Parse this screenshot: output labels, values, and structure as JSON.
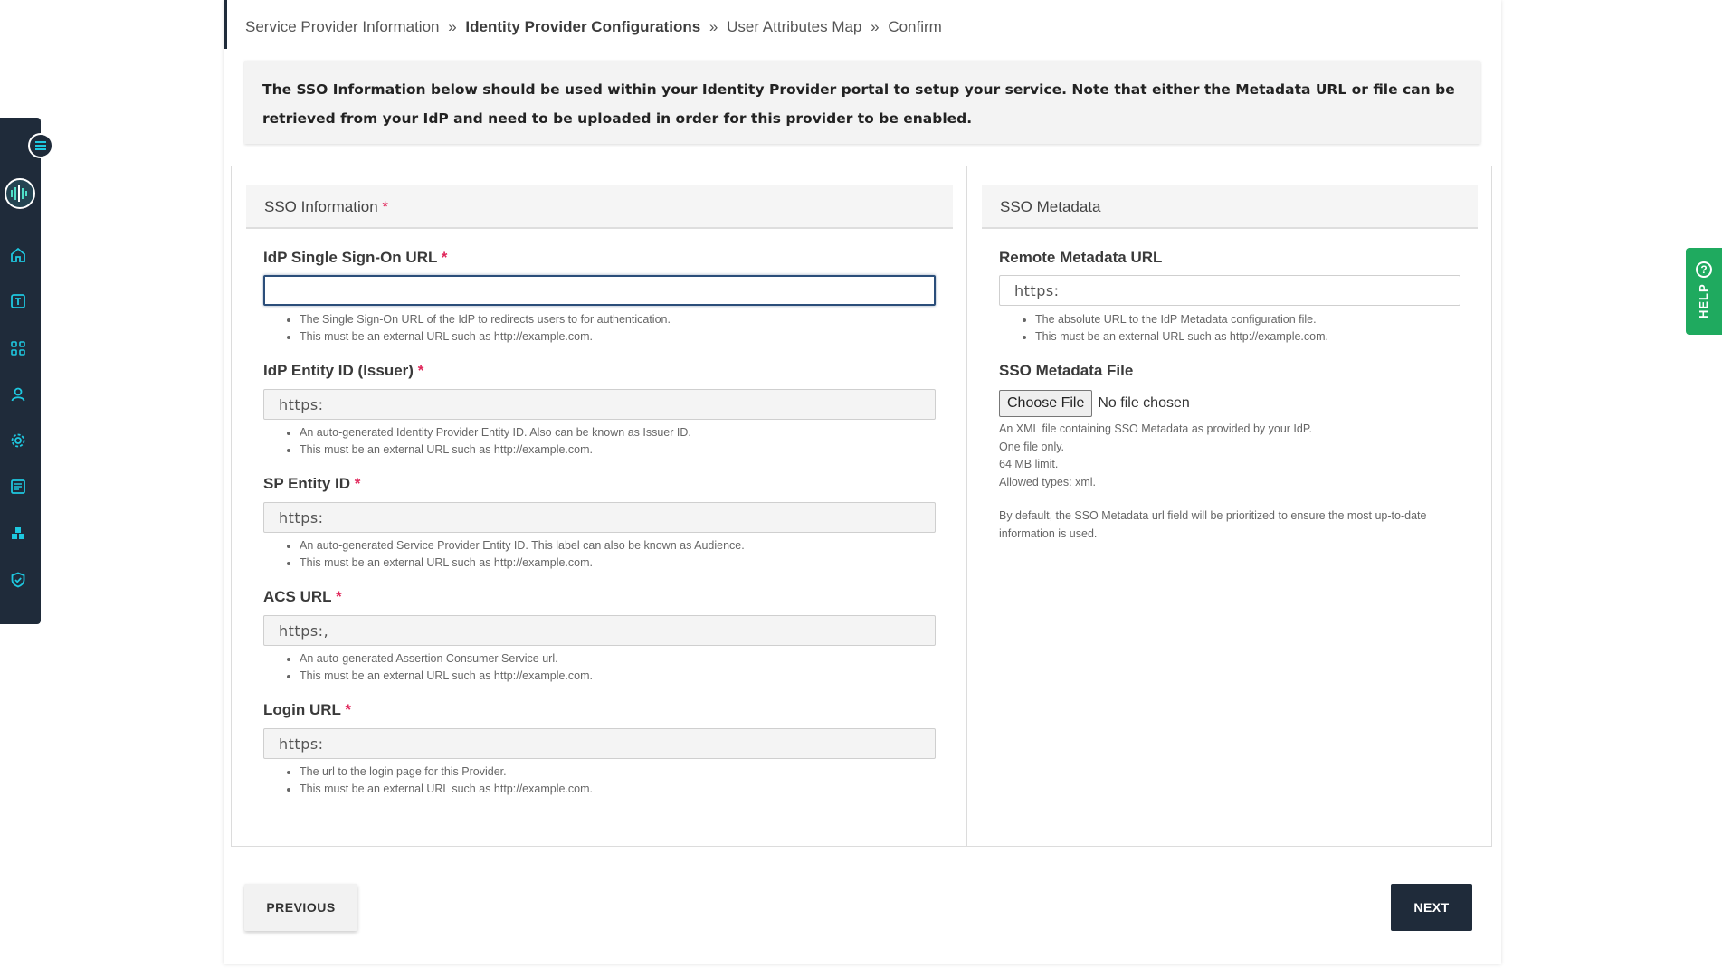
{
  "breadcrumb": {
    "step1": "Service Provider Information",
    "step2": "Identity Provider Configurations",
    "step3": "User Attributes Map",
    "step4": "Confirm",
    "separator": "»"
  },
  "notice": "The SSO Information below should be used within your Identity Provider portal to setup your service. Note that either the Metadata URL or file can be retrieved from your IdP and need to be uploaded in order for this provider to be enabled.",
  "sso_info": {
    "title": "SSO Information",
    "required_mark": "*",
    "fields": [
      {
        "label": "IdP Single Sign-On URL",
        "value": "",
        "help": [
          "The Single Sign-On URL of the IdP to redirects users to for authentication.",
          "This must be an external URL such as http://example.com."
        ]
      },
      {
        "label": "IdP Entity ID (Issuer)",
        "value": "https:",
        "help": [
          "An auto-generated Identity Provider Entity ID. Also can be known as Issuer ID.",
          "This must be an external URL such as http://example.com."
        ]
      },
      {
        "label": "SP Entity ID",
        "value": "https:",
        "help": [
          "An auto-generated Service Provider Entity ID. This label can also be known as Audience.",
          "This must be an external URL such as http://example.com."
        ]
      },
      {
        "label": "ACS URL",
        "value": "https:,",
        "help": [
          "An auto-generated Assertion Consumer Service url.",
          "This must be an external URL such as http://example.com."
        ]
      },
      {
        "label": "Login URL",
        "value": "https:",
        "help": [
          "The url to the login page for this Provider.",
          "This must be an external URL such as http://example.com."
        ]
      }
    ]
  },
  "sso_metadata": {
    "title": "SSO Metadata",
    "remote_label": "Remote Metadata URL",
    "remote_value": "https:",
    "remote_help": [
      "The absolute URL to the IdP Metadata configuration file.",
      "This must be an external URL such as http://example.com."
    ],
    "file_label": "SSO Metadata File",
    "file_button": "Choose File",
    "file_status": "No file chosen",
    "file_notes": [
      "An XML file containing SSO Metadata as provided by your IdP.",
      "One file only.",
      "64 MB limit.",
      "Allowed types: xml."
    ],
    "priority_note": "By default, the SSO Metadata url field will be prioritized to ensure the most up-to-date information is used."
  },
  "buttons": {
    "previous": "PREVIOUS",
    "next": "NEXT"
  },
  "help_tab": {
    "label": "HELP",
    "icon": "?"
  },
  "colors": {
    "sidebar": "#1f2b3a",
    "accent_icon": "#1ec8e0",
    "required": "#e0265a",
    "help_tab": "#1faa5f",
    "next_button": "#1f2b3a"
  }
}
